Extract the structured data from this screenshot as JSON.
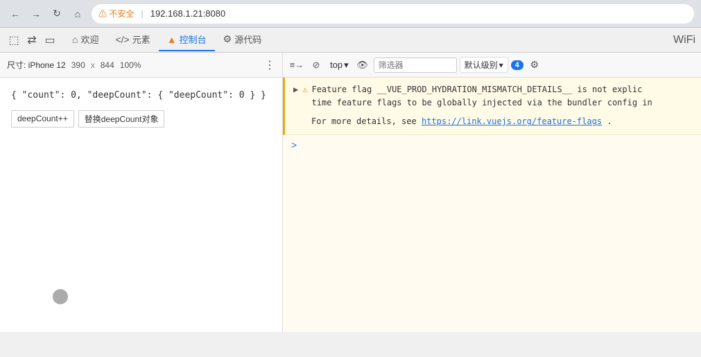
{
  "browser": {
    "back_label": "←",
    "forward_label": "→",
    "reload_label": "↻",
    "home_label": "⌂",
    "security_warning": "⚠ 不安全",
    "separator": "|",
    "url": "192.168.1.21:8080",
    "more_label": "⋮"
  },
  "devtools_tabs": [
    {
      "id": "welcome",
      "icon": "⌂",
      "label": "欢迎"
    },
    {
      "id": "elements",
      "icon": "</>",
      "label": "元素"
    },
    {
      "id": "console",
      "icon": "▤",
      "label": "控制台",
      "active": true,
      "has_warning": true
    },
    {
      "id": "sources",
      "icon": "⚡",
      "label": "源代码"
    }
  ],
  "device_toolbar": {
    "device_name": "尺寸: iPhone 12",
    "width": "390",
    "x": "x",
    "height": "844",
    "zoom": "100%",
    "more": "⋮"
  },
  "app": {
    "json_display": "{ \"count\": 0, \"deepCount\": { \"deepCount\": 0 } }",
    "button1": "deepCount++",
    "button2": "替换deepCount对象"
  },
  "console_toolbar": {
    "clear_icon": "🚫",
    "top_label": "top",
    "dropdown_icon": "▾",
    "eye_icon": "👁",
    "filter_placeholder": "筛选器",
    "level_label": "默认级别",
    "dropdown2_icon": "▾",
    "badge_count": "4",
    "gear_icon": "⚙"
  },
  "console": {
    "warning": {
      "icon": "⚠",
      "line1": "Feature flag __VUE_PROD_HYDRATION_MISMATCH_DETAILS__ is not explic",
      "line2": "time feature flags to be globally injected via the bundler config in",
      "line3": "",
      "line4": "For more details, see ",
      "link": "https://link.vuejs.org/feature-flags",
      "link_suffix": "."
    },
    "prompt_icon": ">"
  }
}
